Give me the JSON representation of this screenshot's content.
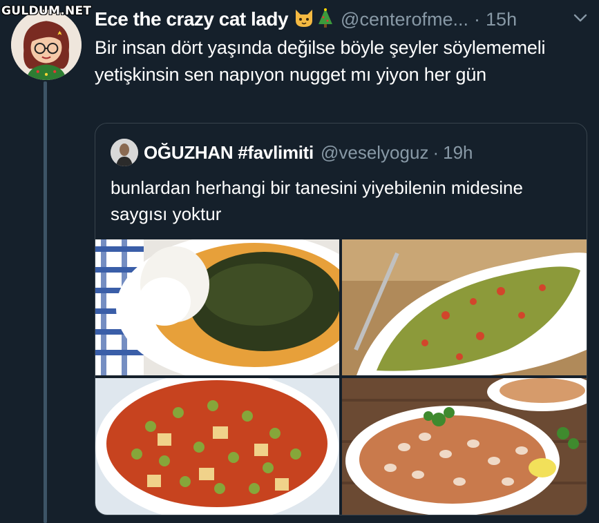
{
  "watermark": "GULDUM.NET",
  "tweet": {
    "author_name": "Ece the crazy cat lady",
    "author_emojis": [
      "cat-face-icon",
      "christmas-tree-icon"
    ],
    "handle": "@centerofme...",
    "separator": "·",
    "time": "15h",
    "text": "Bir insan dört yaşında değilse böyle şeyler söylememeli yetişkinsin sen napıyon nugget mı yiyon her gün"
  },
  "quoted": {
    "author_name": "OĞUZHAN #favlimiti",
    "handle": "@veselyoguz",
    "separator": "·",
    "time": "19h",
    "text": "bunlardan herhangi bir tanesini yiyebilenin midesine saygısı yoktur",
    "photos": [
      {
        "name": "spinach-with-yogurt-photo"
      },
      {
        "name": "green-beans-photo"
      },
      {
        "name": "peas-stew-photo"
      },
      {
        "name": "bean-stew-photo"
      }
    ]
  },
  "colors": {
    "background": "#15202b",
    "secondary_text": "#8899a6",
    "border": "#38444d"
  }
}
